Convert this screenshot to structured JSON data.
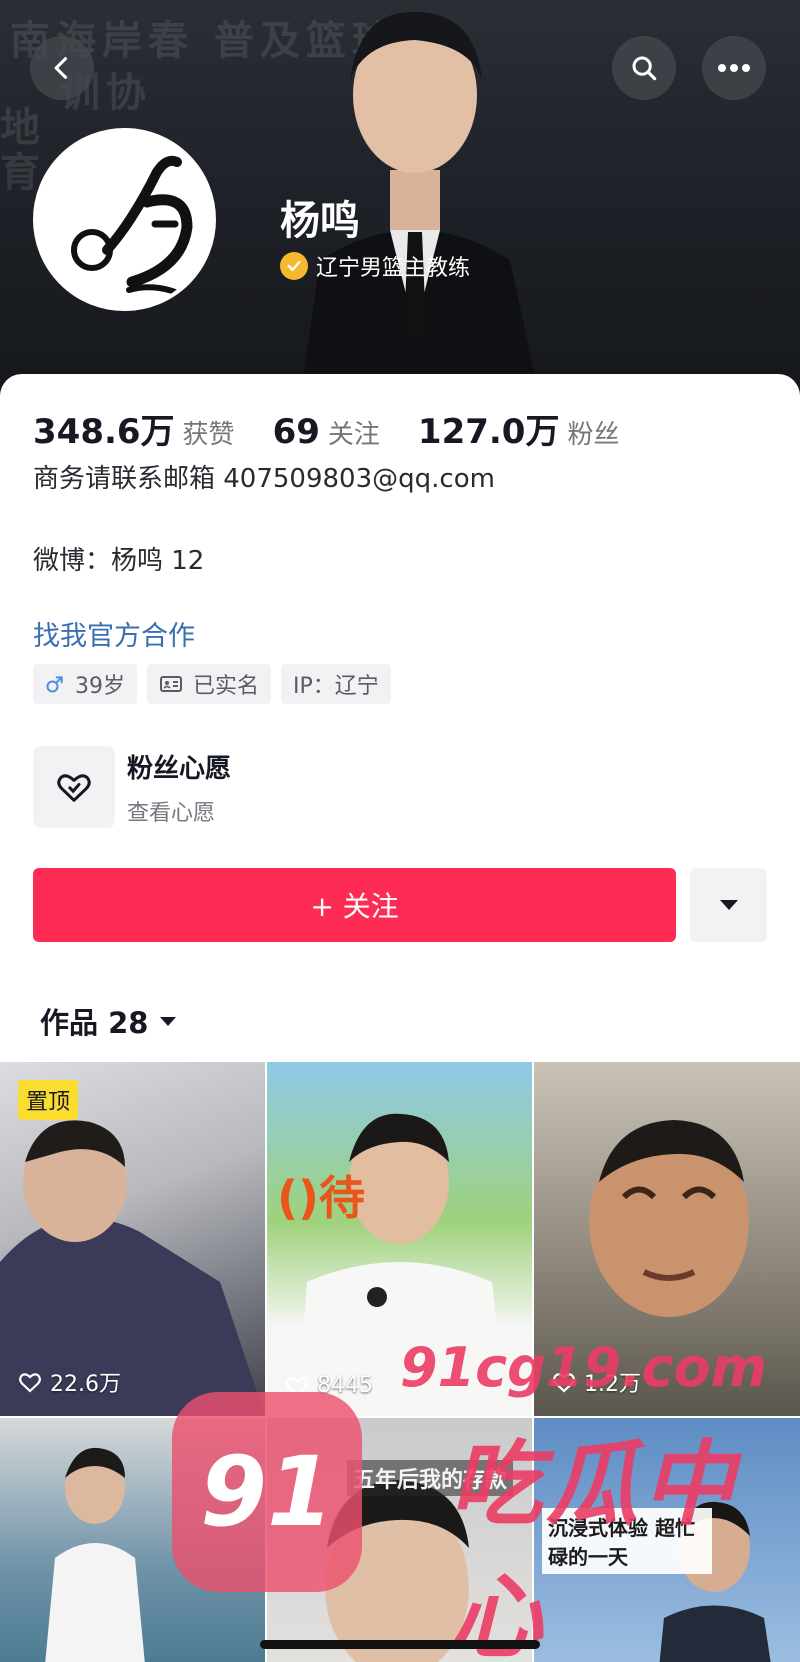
{
  "cover": {
    "background_text": [
      "南海岸春 普及篮球",
      "训协",
      "地",
      "育"
    ]
  },
  "header": {
    "back_icon": "chevron-left-icon",
    "search_icon": "search-icon",
    "more_icon": "ellipsis-icon"
  },
  "profile": {
    "name": "杨鸣",
    "verification": "辽宁男篮主教练",
    "verify_color": "#f5b82e",
    "avatar_text": "鸣"
  },
  "stats": [
    {
      "value": "348.6万",
      "label": "获赞"
    },
    {
      "value": "69",
      "label": "关注"
    },
    {
      "value": "127.0万",
      "label": "粉丝"
    }
  ],
  "bio": {
    "line1": "商务请联系邮箱  407509803@qq.com",
    "line2": "微博：杨鸣 12",
    "link": "找我官方合作"
  },
  "tags": {
    "gender_icon": "male-icon",
    "age": "39岁",
    "id_icon": "id-card-icon",
    "verified": "已实名",
    "ip": "IP：辽宁"
  },
  "wish": {
    "icon": "heart-check-icon",
    "title": "粉丝心愿",
    "subtitle": "查看心愿"
  },
  "actions": {
    "follow": "+ 关注",
    "follow_color": "#fe2c55",
    "dropdown_icon": "triangle-down-icon"
  },
  "works": {
    "label": "作品 28"
  },
  "videos": [
    {
      "pinned": "置顶",
      "likes": "22.6万",
      "caption": ""
    },
    {
      "pinned": "",
      "likes": "8445",
      "caption": "()待"
    },
    {
      "pinned": "",
      "likes": "1.2万",
      "caption": ""
    },
    {
      "pinned": "",
      "likes": "",
      "caption": ""
    },
    {
      "pinned": "",
      "likes": "",
      "caption": "五年后我的存款"
    },
    {
      "pinned": "",
      "likes": "",
      "caption": "沉浸式体验 超忙碌的一天"
    }
  ],
  "watermark": {
    "badge": "91",
    "site": "91cg19.com",
    "title": "吃瓜中心"
  }
}
